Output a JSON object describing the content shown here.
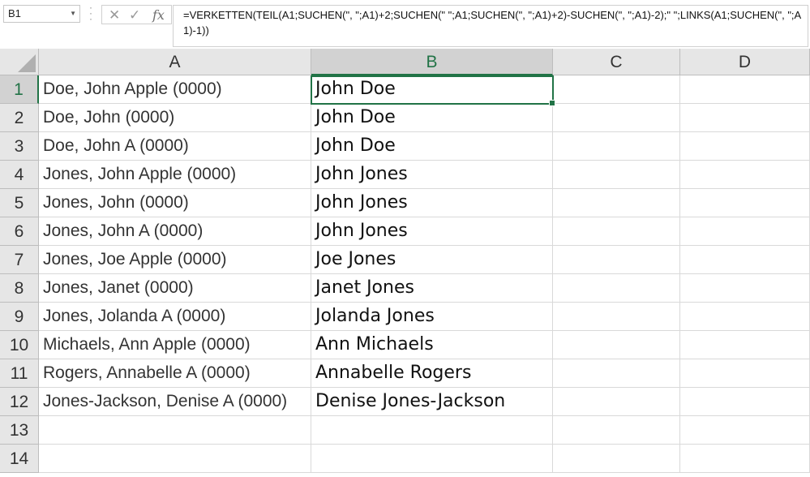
{
  "name_box": "B1",
  "formula": "=VERKETTEN(TEIL(A1;SUCHEN(\", \";A1)+2;SUCHEN(\" \";A1;SUCHEN(\", \";A1)+2)-SUCHEN(\", \";A1)-2);\" \";LINKS(A1;SUCHEN(\", \";A1)-1))",
  "fx_symbol": "fx",
  "columns": [
    "A",
    "B",
    "C",
    "D"
  ],
  "rows": [
    {
      "num": "1",
      "a": "Doe, John Apple (0000)",
      "b": "John Doe"
    },
    {
      "num": "2",
      "a": "Doe, John (0000)",
      "b": "John Doe"
    },
    {
      "num": "3",
      "a": "Doe, John A (0000)",
      "b": "John Doe"
    },
    {
      "num": "4",
      "a": "Jones, John Apple (0000)",
      "b": "John Jones"
    },
    {
      "num": "5",
      "a": "Jones, John (0000)",
      "b": "John Jones"
    },
    {
      "num": "6",
      "a": "Jones, John A (0000)",
      "b": "John Jones"
    },
    {
      "num": "7",
      "a": "Jones, Joe Apple (0000)",
      "b": "Joe Jones"
    },
    {
      "num": "8",
      "a": "Jones, Janet (0000)",
      "b": "Janet Jones"
    },
    {
      "num": "9",
      "a": "Jones, Jolanda A (0000)",
      "b": "Jolanda Jones"
    },
    {
      "num": "10",
      "a": "Michaels, Ann Apple (0000)",
      "b": "Ann Michaels"
    },
    {
      "num": "11",
      "a": "Rogers, Annabelle A (0000)",
      "b": "Annabelle Rogers"
    },
    {
      "num": "12",
      "a": "Jones-Jackson, Denise A (0000)",
      "b": "Denise Jones-Jackson"
    },
    {
      "num": "13",
      "a": "",
      "b": ""
    },
    {
      "num": "14",
      "a": "",
      "b": ""
    }
  ],
  "selected_column": "B",
  "selected_row": "1",
  "accent_color": "#217346"
}
